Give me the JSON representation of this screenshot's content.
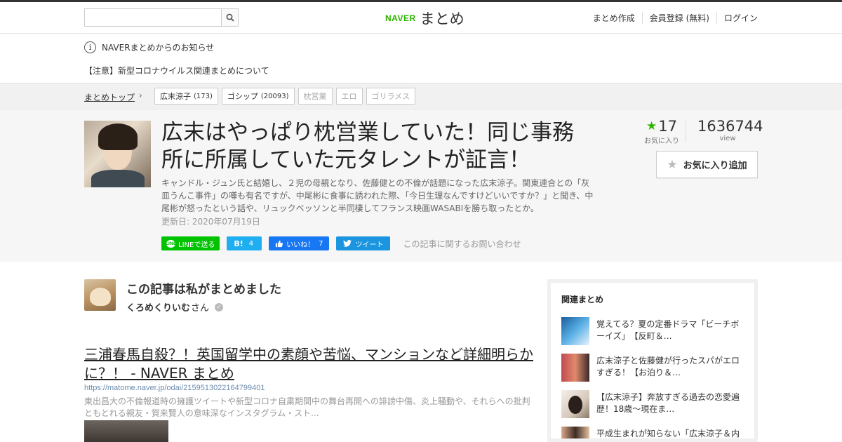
{
  "header": {
    "search_placeholder": "",
    "logo_naver": "NAVER",
    "logo_matome": "まとめ",
    "nav": [
      "まとめ作成",
      "会員登録 (無料)",
      "ログイン"
    ]
  },
  "notice": {
    "info_icon": "i",
    "title": "NAVERまとめからのお知らせ",
    "item": "【注意】新型コロナウイルス関連まとめについて"
  },
  "breadcrumb": {
    "top": "まとめトップ",
    "chevron": "›",
    "tags": [
      {
        "label": "広末涼子",
        "count": "(173)"
      },
      {
        "label": "ゴシップ",
        "count": "(20093)"
      },
      {
        "label": "枕営業",
        "count": ""
      },
      {
        "label": "エロ",
        "count": ""
      },
      {
        "label": "ゴリラメス",
        "count": ""
      }
    ]
  },
  "article": {
    "title": "広末はやっぱり枕営業していた！同じ事務所に所属していた元タレントが証言！",
    "description": "キャンドル・ジュン氏と結婚し、２児の母親となり、佐藤健との不倫が話題になった広末涼子。関東連合との「灰皿うんこ事件」の噂も有名ですが、中尾彬に食事に誘われた際、「今日生理なんですけどいいですか？」と聞き、中尾彬が怒ったという話や、リュックベッソンと半同棲してフランス映画WASABIを勝ち取ったとか。",
    "updated": "更新日: 2020年07月19日",
    "favorites": "17",
    "favorites_label": "お気に入り",
    "views": "1636744",
    "views_label": "view",
    "fav_add_label": "お気に入り追加"
  },
  "share": {
    "line": "LINEで送る",
    "line_icon_text": "LINE",
    "hatena": "B!",
    "hatena_count": "4",
    "facebook": "いいね！",
    "facebook_count": "7",
    "twitter": "ツイート",
    "inquiry": "この記事に関するお問い合わせ"
  },
  "author": {
    "heading": "この記事は私がまとめました",
    "name": "くろめくりいむ",
    "suffix": "さん"
  },
  "link_card": {
    "title": "三浦春馬自殺？！英国留学中の素顔や苦悩、マンションなど詳細明らかに？！ - NAVER まとめ",
    "url": "https://matome.naver.jp/odai/2159513022164799401",
    "description": "東出昌大の不倫報道時の擁護ツイートや新型コロナ自粛期間中の舞台再開への誹謗中傷、炎上騒動や、それらへの批判ともとれる親友・賀来賢人の意味深なインスタグラム・スト..."
  },
  "sidebar": {
    "heading": "関連まとめ",
    "items": [
      {
        "title": "覚えてる？夏の定番ドラマ「ビーチボーイズ」　【反町＆…"
      },
      {
        "title": "広末涼子と佐藤健が行ったスパがエロすぎる！【お泊り＆…"
      },
      {
        "title": "【広末涼子】奔放すぎる過去の恋愛遍歴！18歳〜現在ま…"
      },
      {
        "title": "平成生まれが知らない「広末涼子＆内田有紀」アイドル無…"
      }
    ]
  },
  "colors": {
    "naver_green": "#2db400",
    "line_green": "#00c300",
    "hatena_blue": "#1faeef",
    "facebook_blue": "#1877f2",
    "twitter_blue": "#1b95e0"
  }
}
